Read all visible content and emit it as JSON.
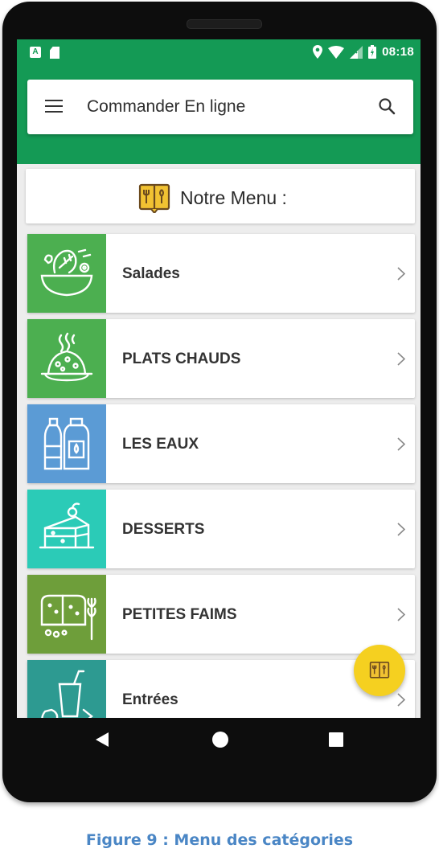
{
  "status_bar": {
    "time": "08:18",
    "icons": [
      "notification-a-icon",
      "sd-card-icon",
      "location-icon",
      "wifi-icon",
      "signal-icon",
      "battery-icon"
    ]
  },
  "toolbar": {
    "title": "Commander En ligne",
    "menu_icon": "hamburger-icon",
    "search_icon": "search-icon"
  },
  "menu_header": {
    "title": "Notre Menu :",
    "icon": "menu-book-icon"
  },
  "categories": [
    {
      "label": "Salades",
      "icon": "salad-icon",
      "color": "#4caf50"
    },
    {
      "label": "PLATS CHAUDS",
      "icon": "hot-dish-icon",
      "color": "#4caf50"
    },
    {
      "label": "LES EAUX",
      "icon": "water-bottle-icon",
      "color": "#5b9bd5"
    },
    {
      "label": "DESSERTS",
      "icon": "cake-icon",
      "color": "#2bcbb7"
    },
    {
      "label": "PETITES FAIMS",
      "icon": "bread-icon",
      "color": "#6e9e3a"
    },
    {
      "label": "Entrées",
      "icon": "drink-fruit-icon",
      "color": "#2d9a91"
    }
  ],
  "fab": {
    "icon": "menu-book-icon"
  },
  "nav": {
    "back": "back-icon",
    "home": "home-icon",
    "recent": "recent-apps-icon"
  },
  "caption": "Figure 9 : Menu des catégories",
  "colors": {
    "primary": "#149a55",
    "fab": "#f5d020",
    "caption": "#4a86c5"
  }
}
